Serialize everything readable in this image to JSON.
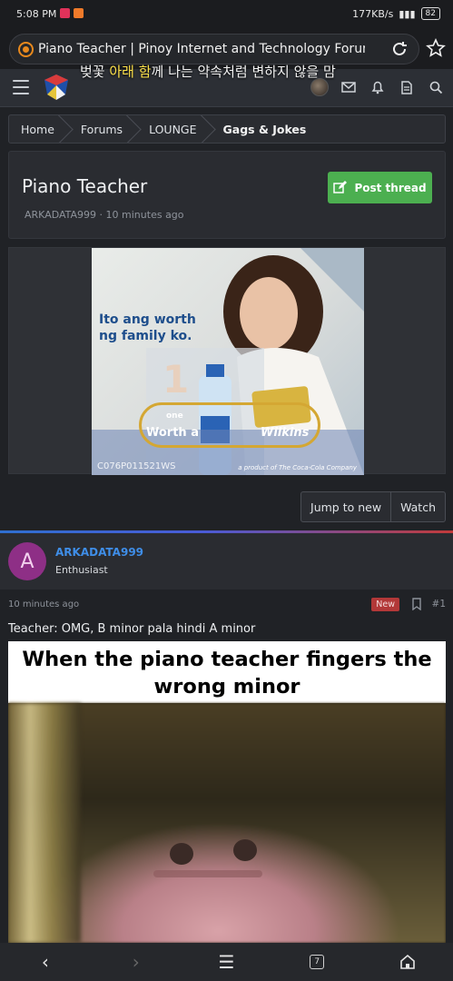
{
  "status_bar": {
    "time": "5:08 PM",
    "speed": "177KB/s",
    "battery": "82"
  },
  "browser": {
    "url_title": "Piano Teacher | Pinoy Internet and Technology Forums"
  },
  "overlay": {
    "text_plain_1": "벚꽃 ",
    "text_hl": "아래 함",
    "text_plain_2": "께 나는 약속처럼 변하지 않을 맘"
  },
  "breadcrumb": [
    "Home",
    "Forums",
    "LOUNGE",
    "Gags & Jokes"
  ],
  "thread": {
    "title": "Piano Teacher",
    "author": "ARKADATA999",
    "time": "10 minutes ago",
    "post_thread_label": "Post thread"
  },
  "ad": {
    "tagline_1": "Ito ang worth",
    "tagline_2": "ng family ko.",
    "one": "one",
    "worth": "Worth a",
    "brand": "Wilkins",
    "code": "C076P011521WS",
    "footnote": "a product of The Coca-Cola Company"
  },
  "actions": {
    "jump_label": "Jump to new",
    "watch_label": "Watch"
  },
  "post": {
    "avatar_letter": "A",
    "username": "ARKADATA999",
    "user_title": "Enthusiast",
    "time": "10 minutes ago",
    "badge": "New",
    "number": "#1",
    "text": "Teacher: OMG, B minor pala hindi A minor",
    "meme_caption": "When the piano teacher fingers the wrong minor"
  },
  "bottom_nav": {
    "tab_count": "7"
  },
  "colors": {
    "accent_green": "#4caf50",
    "username_blue": "#3f8ee8",
    "new_badge": "#b23838",
    "avatar_purple": "#8e2f86"
  }
}
